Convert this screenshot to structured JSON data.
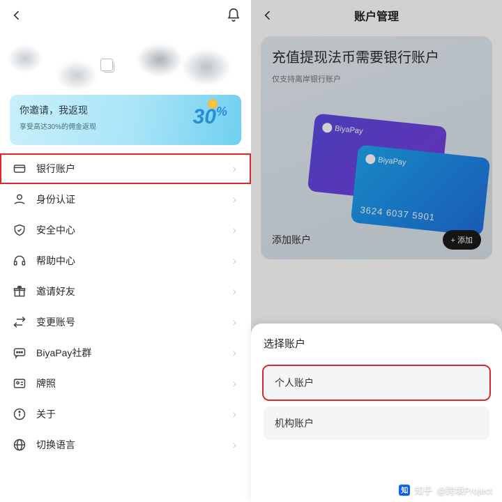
{
  "left": {
    "banner": {
      "title": "你邀请，我返现",
      "subtitle": "享受高达30%的佣金返现",
      "percent": "30",
      "percent_suffix": "%"
    },
    "menu": [
      {
        "key": "bank",
        "label": "银行账户",
        "icon": "card-icon"
      },
      {
        "key": "identity",
        "label": "身份认证",
        "icon": "person-icon"
      },
      {
        "key": "security",
        "label": "安全中心",
        "icon": "shield-icon"
      },
      {
        "key": "help",
        "label": "帮助中心",
        "icon": "headset-icon"
      },
      {
        "key": "invite",
        "label": "邀请好友",
        "icon": "gift-icon"
      },
      {
        "key": "switch",
        "label": "变更账号",
        "icon": "swap-icon"
      },
      {
        "key": "community",
        "label": "BiyaPay社群",
        "icon": "chat-icon"
      },
      {
        "key": "license",
        "label": "牌照",
        "icon": "id-icon"
      },
      {
        "key": "about",
        "label": "关于",
        "icon": "info-icon"
      },
      {
        "key": "language",
        "label": "切换语言",
        "icon": "globe-icon"
      }
    ]
  },
  "right": {
    "title": "账户管理",
    "banner": {
      "title": "充值提现法币需要银行账户",
      "subtitle": "仅支持离岸银行账户",
      "card_brand": "BiyaPay",
      "card_number": "3624 6037 5901",
      "add_label": "添加账户",
      "add_button": "+ 添加"
    },
    "sheet": {
      "title": "选择账户",
      "options": [
        {
          "key": "personal",
          "label": "个人账户"
        },
        {
          "key": "org",
          "label": "机构账户"
        }
      ]
    }
  },
  "watermark": {
    "site": "知乎",
    "author": "@跨境Project"
  }
}
